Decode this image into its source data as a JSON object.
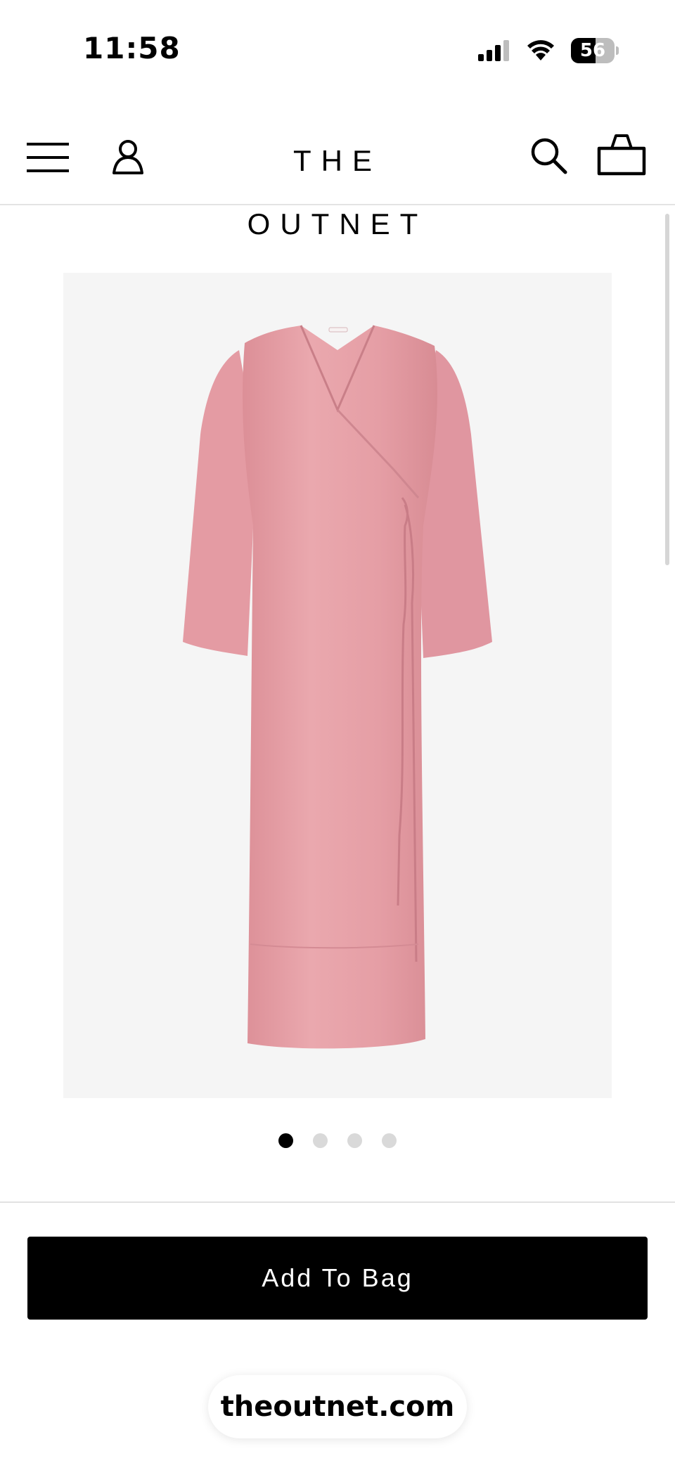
{
  "status_bar": {
    "time": "11:58",
    "battery_level": "56",
    "battery_fraction": 0.56,
    "icons": [
      "cellular-signal-icon",
      "wifi-icon",
      "battery-icon"
    ]
  },
  "nav": {
    "brand": "THE OUTNET",
    "icons": [
      "menu-icon",
      "account-icon",
      "search-icon",
      "shopping-bag-icon"
    ]
  },
  "product": {
    "image": "pink-satin-wrap-midi-dress",
    "dress_color": "#e8a1a8",
    "carousel": {
      "total": 4,
      "active_index": 0
    }
  },
  "actions": {
    "add_to_bag_label": "Add To Bag"
  },
  "browser": {
    "url": "theoutnet.com"
  },
  "colors": {
    "button_bg": "#000000",
    "image_bg": "#f5f5f5"
  }
}
